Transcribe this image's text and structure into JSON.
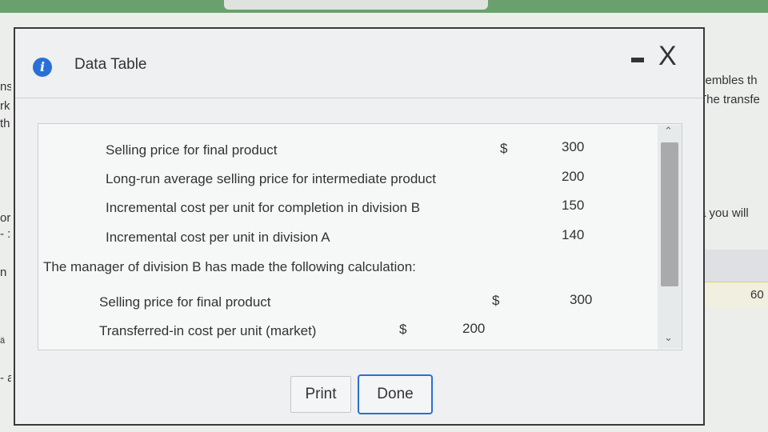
{
  "background": {
    "left_fragments": [
      "ns",
      "rk",
      "th",
      "or",
      "- :",
      "n",
      "ä",
      "- a"
    ],
    "right_fragments": [
      "sembles th",
      "The transfe",
      "a you will",
      "60"
    ]
  },
  "dialog": {
    "title": "Data Table",
    "minimize_label": "-",
    "close_label": "X"
  },
  "table": {
    "rows": [
      {
        "label": "Selling price for final product",
        "currency": "$",
        "value": "300"
      },
      {
        "label": "Long-run average selling price for intermediate product",
        "currency": "",
        "value": "200"
      },
      {
        "label": "Incremental cost per unit for completion in division B",
        "currency": "",
        "value": "150"
      },
      {
        "label": "Incremental cost per unit in division A",
        "currency": "",
        "value": "140"
      }
    ],
    "calc_intro": "The manager of division B has made the following calculation:",
    "calc_rows": [
      {
        "label": "Selling price for final product",
        "currency": "$",
        "value": "300"
      },
      {
        "label": "Transferred-in cost per unit (market)",
        "currency": "$",
        "value": "200"
      }
    ]
  },
  "buttons": {
    "print": "Print",
    "done": "Done"
  },
  "colors": {
    "accent": "#2a6fd6",
    "top_bar": "#6aa06e"
  }
}
